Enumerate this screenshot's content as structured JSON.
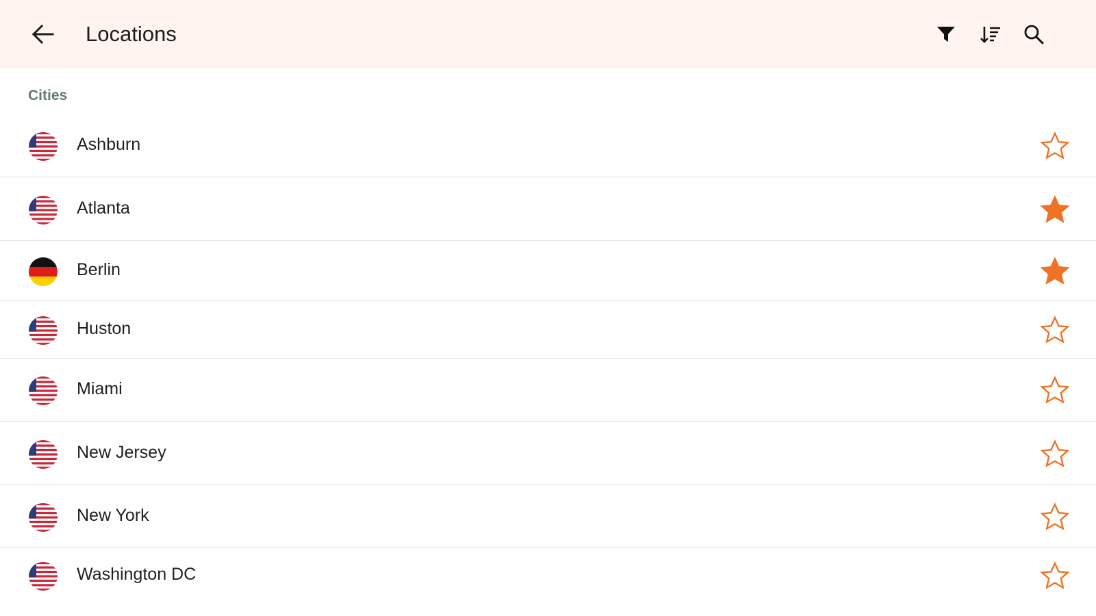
{
  "header": {
    "title": "Locations",
    "background": "#fff4ef"
  },
  "section": {
    "label": "Cities"
  },
  "accent_color": "#ee7326",
  "cities": [
    {
      "name": "Ashburn",
      "flag": "us-flag-icon",
      "favorite": false
    },
    {
      "name": "Atlanta",
      "flag": "us-flag-icon",
      "favorite": true
    },
    {
      "name": "Berlin",
      "flag": "germany-flag-icon",
      "favorite": true
    },
    {
      "name": "Huston",
      "flag": "us-flag-icon",
      "favorite": false
    },
    {
      "name": "Miami",
      "flag": "us-flag-icon",
      "favorite": false
    },
    {
      "name": "New Jersey",
      "flag": "us-flag-icon",
      "favorite": false
    },
    {
      "name": "New York",
      "flag": "us-flag-icon",
      "favorite": false
    },
    {
      "name": "Washington DC",
      "flag": "us-flag-icon",
      "favorite": false
    }
  ]
}
